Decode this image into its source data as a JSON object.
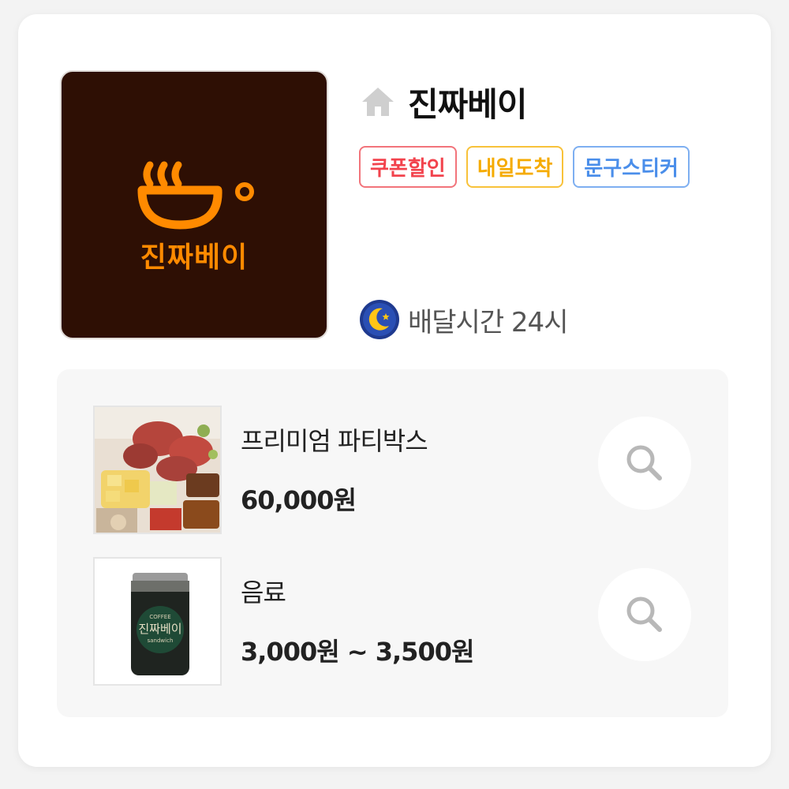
{
  "store": {
    "name": "진짜베이",
    "logo_text": "진짜베이",
    "icon": "home-icon",
    "badges": [
      {
        "label": "쿠폰할인",
        "color": "#f2434d"
      },
      {
        "label": "내일도착",
        "color": "#f5ab00"
      },
      {
        "label": "문구스티커",
        "color": "#4a8eea"
      }
    ],
    "delivery": {
      "icon": "moon-icon",
      "label": "배달시간 24시"
    }
  },
  "menu": [
    {
      "name": "프리미엄 파티박스",
      "price": "60,000원",
      "action_icon": "search-icon"
    },
    {
      "name": "음료",
      "price": "3,000원 ~ 3,500원",
      "action_icon": "search-icon"
    }
  ],
  "drink_can": {
    "line1": "COFFEE",
    "line2": "진짜베이",
    "line3": "sandwich"
  },
  "colors": {
    "brand_orange": "#ff8a00",
    "logo_bg": "#2e0f04"
  }
}
